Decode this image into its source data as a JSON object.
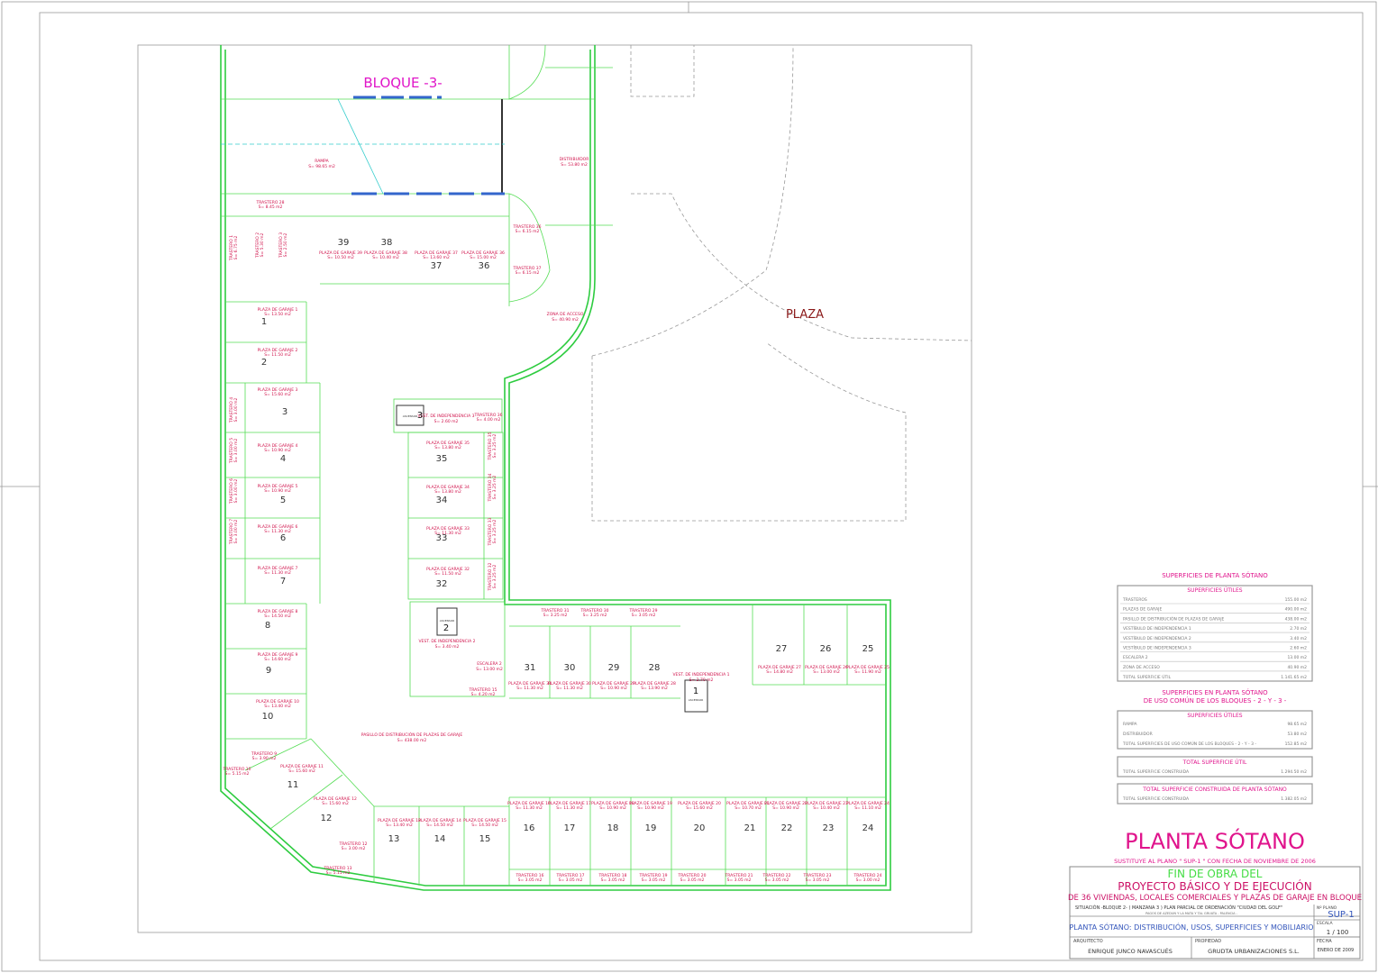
{
  "drawing": {
    "block_label": "BLOQUE -3-",
    "plaza_label": "PLAZA",
    "ramp": {
      "name": "RAMPA",
      "area": "S= 98.65 m2"
    },
    "distributor": {
      "name": "DISTRIBUIDOR",
      "area": "S= 53.80 m2"
    },
    "access_zone": {
      "name": "ZONA DE ACCESO",
      "area": "S= 40.90 m2"
    },
    "corridor": {
      "name": "PASILLO DE DISTRIBUCIÓN DE PLAZAS DE GARAJE",
      "area": "S= 438.00 m2"
    },
    "staircase": {
      "name": "ESCALERA 2",
      "area": "S= 13.00 m2"
    },
    "vestibules": [
      {
        "name": "VEST. DE INDEPENDENCIA 3",
        "area": "S= 2.60 m2"
      },
      {
        "name": "VEST. DE INDEPENDENCIA 2",
        "area": "S= 3.40 m2"
      },
      {
        "name": "VEST. DE INDEPENDENCIA 1",
        "area": "S= 2.70 m2"
      }
    ],
    "lifts": [
      "3",
      "2",
      "1"
    ],
    "lift_label": "ASCENSOR",
    "parking": [
      {
        "n": "1",
        "label": "PLAZA DE GARAJE 1",
        "area": "S= 13.50 m2"
      },
      {
        "n": "2",
        "label": "PLAZA DE GARAJE 2",
        "area": "S= 11.50 m2"
      },
      {
        "n": "3",
        "label": "PLAZA DE GARAJE 3",
        "area": "S= 15.60 m2"
      },
      {
        "n": "4",
        "label": "PLAZA DE GARAJE 4",
        "area": "S= 10.90 m2"
      },
      {
        "n": "5",
        "label": "PLAZA DE GARAJE 5",
        "area": "S= 10.90 m2"
      },
      {
        "n": "6",
        "label": "PLAZA DE GARAJE 6",
        "area": "S= 11.30 m2"
      },
      {
        "n": "7",
        "label": "PLAZA DE GARAJE 7",
        "area": "S= 11.30 m2"
      },
      {
        "n": "8",
        "label": "PLAZA DE GARAJE 8",
        "area": "S= 14.50 m2"
      },
      {
        "n": "9",
        "label": "PLAZA DE GARAJE 9",
        "area": "S= 14.60 m2"
      },
      {
        "n": "10",
        "label": "PLAZA DE GARAJE 10",
        "area": "S= 13.40 m2"
      },
      {
        "n": "11",
        "label": "PLAZA DE GARAJE 11",
        "area": "S= 15.60 m2"
      },
      {
        "n": "12",
        "label": "PLAZA DE GARAJE 12",
        "area": "S= 15.60 m2"
      },
      {
        "n": "13",
        "label": "PLAZA DE GARAJE 13",
        "area": "S= 13.40 m2"
      },
      {
        "n": "14",
        "label": "PLAZA DE GARAJE 14",
        "area": "S= 14.50 m2"
      },
      {
        "n": "15",
        "label": "PLAZA DE GARAJE 15",
        "area": "S= 14.50 m2"
      },
      {
        "n": "16",
        "label": "PLAZA DE GARAJE 16",
        "area": "S= 11.30 m2"
      },
      {
        "n": "17",
        "label": "PLAZA DE GARAJE 17",
        "area": "S= 11.30 m2"
      },
      {
        "n": "18",
        "label": "PLAZA DE GARAJE 18",
        "area": "S= 10.90 m2"
      },
      {
        "n": "19",
        "label": "PLAZA DE GARAJE 19",
        "area": "S= 10.90 m2"
      },
      {
        "n": "20",
        "label": "PLAZA DE GARAJE 20",
        "area": "S= 15.60 m2"
      },
      {
        "n": "21",
        "label": "PLAZA DE GARAJE 21",
        "area": "S= 10.70 m2"
      },
      {
        "n": "22",
        "label": "PLAZA DE GARAJE 22",
        "area": "S= 10.90 m2"
      },
      {
        "n": "23",
        "label": "PLAZA DE GARAJE 23",
        "area": "S= 10.40 m2"
      },
      {
        "n": "24",
        "label": "PLAZA DE GARAJE 24",
        "area": "S= 11.10 m2"
      },
      {
        "n": "25",
        "label": "PLAZA DE GARAJE 25",
        "area": "S= 11.90 m2"
      },
      {
        "n": "26",
        "label": "PLAZA DE GARAJE 26",
        "area": "S= 13.00 m2"
      },
      {
        "n": "27",
        "label": "PLAZA DE GARAJE 27",
        "area": "S= 14.80 m2"
      },
      {
        "n": "28",
        "label": "PLAZA DE GARAJE 28",
        "area": "S= 13.90 m2"
      },
      {
        "n": "29",
        "label": "PLAZA DE GARAJE 29",
        "area": "S= 10.90 m2"
      },
      {
        "n": "30",
        "label": "PLAZA DE GARAJE 30",
        "area": "S= 11.30 m2"
      },
      {
        "n": "31",
        "label": "PLAZA DE GARAJE 31",
        "area": "S= 11.30 m2"
      },
      {
        "n": "32",
        "label": "PLAZA DE GARAJE 32",
        "area": "S= 11.50 m2"
      },
      {
        "n": "33",
        "label": "PLAZA DE GARAJE 33",
        "area": "S= 11.30 m2"
      },
      {
        "n": "34",
        "label": "PLAZA DE GARAJE 34",
        "area": "S= 13.80 m2"
      },
      {
        "n": "35",
        "label": "PLAZA DE GARAJE 35",
        "area": "S= 13.80 m2"
      },
      {
        "n": "36",
        "label": "PLAZA DE GARAJE 36",
        "area": "S= 15.00 m2"
      },
      {
        "n": "37",
        "label": "PLAZA DE GARAJE 37",
        "area": "S= 13.60 m2"
      },
      {
        "n": "38",
        "label": "PLAZA DE GARAJE 38",
        "area": "S= 10.40 m2"
      },
      {
        "n": "39",
        "label": "PLAZA DE GARAJE 39",
        "area": "S= 10.50 m2"
      }
    ],
    "storage": [
      {
        "label": "TRASTERO 1",
        "area": "S= 6.75 m2"
      },
      {
        "label": "TRASTERO 2",
        "area": "S= 5.30 m2"
      },
      {
        "label": "TRASTERO 3",
        "area": "S= 2.50 m2"
      },
      {
        "label": "TRASTERO 4",
        "area": "S= 3.00 m2"
      },
      {
        "label": "TRASTERO 5",
        "area": "S= 3.00 m2"
      },
      {
        "label": "TRASTERO 6",
        "area": "S= 3.00 m2"
      },
      {
        "label": "TRASTERO 7",
        "area": "S= 3.00 m2"
      },
      {
        "label": "TRASTERO 9",
        "area": "S= 3.90 m2"
      },
      {
        "label": "TRASTERO 10",
        "area": "S= 5.15 m2"
      },
      {
        "label": "TRASTERO 12",
        "area": "S= 3.00 m2"
      },
      {
        "label": "TRASTERO 13",
        "area": "S= 5.15 m2"
      },
      {
        "label": "TRASTERO 16",
        "area": "S= 3.05 m2"
      },
      {
        "label": "TRASTERO 17",
        "area": "S= 3.05 m2"
      },
      {
        "label": "TRASTERO 18",
        "area": "S= 3.05 m2"
      },
      {
        "label": "TRASTERO 19",
        "area": "S= 3.05 m2"
      },
      {
        "label": "TRASTERO 20",
        "area": "S= 3.05 m2"
      },
      {
        "label": "TRASTERO 21",
        "area": "S= 3.05 m2"
      },
      {
        "label": "TRASTERO 22",
        "area": "S= 3.05 m2"
      },
      {
        "label": "TRASTERO 23",
        "area": "S= 3.05 m2"
      },
      {
        "label": "TRASTERO 24",
        "area": "S= 3.00 m2"
      },
      {
        "label": "TRASTERO 28",
        "area": "S= 8.45 m2"
      },
      {
        "label": "TRASTERO 29",
        "area": "S= 3.05 m2"
      },
      {
        "label": "TRASTERO 30",
        "area": "S= 3.25 m2"
      },
      {
        "label": "TRASTERO 31",
        "area": "S= 3.25 m2"
      },
      {
        "label": "TRASTERO 32",
        "area": "S= 3.25 m2"
      },
      {
        "label": "TRASTERO 33",
        "area": "S= 3.25 m2"
      },
      {
        "label": "TRASTERO 34",
        "area": "S= 3.25 m2"
      },
      {
        "label": "TRASTERO 35",
        "area": "S= 3.25 m2"
      },
      {
        "label": "TRASTERO 36",
        "area": "S= 4.00 m2"
      },
      {
        "label": "TRASTERO 15",
        "area": "S= 4.20 m2"
      },
      {
        "label": "TRASTERO 36",
        "area": "S= 6.15 m2"
      },
      {
        "label": "TRASTERO 37",
        "area": "S= 6.15 m2"
      }
    ]
  },
  "legend": {
    "title": "SUPERFICIES DE PLANTA SÓTANO",
    "useful_header": "SUPERFICIES ÚTILES",
    "useful_rows": [
      {
        "label": "TRASTEROS",
        "value": "155.00 m2"
      },
      {
        "label": "PLAZAS DE GARAJE",
        "value": "490.00 m2"
      },
      {
        "label": "PASILLO DE DISTRIBUCIÓN DE PLAZAS DE GARAJE",
        "value": "438.00 m2"
      },
      {
        "label": "VESTÍBULO DE INDEPENDENCIA 1",
        "value": "2.70 m2"
      },
      {
        "label": "VESTÍBULO DE INDEPENDENCIA 2",
        "value": "3.40 m2"
      },
      {
        "label": "VESTÍBULO DE INDEPENDENCIA 3",
        "value": "2.60 m2"
      },
      {
        "label": "ESCALERA 2",
        "value": "13.00 m2"
      },
      {
        "label": "ZONA DE ACCESO",
        "value": "40.90 m2"
      }
    ],
    "useful_total": {
      "label": "TOTAL SUPERFICIE ÚTIL",
      "value": "1.141.65 m2"
    },
    "common_title_1": "SUPERFICIES EN PLANTA SÓTANO",
    "common_title_2": "DE USO COMÚN DE LOS BLOQUES - 2 - Y - 3 -",
    "common_header": "SUPERFICIES ÚTILES",
    "common_rows": [
      {
        "label": "RAMPA",
        "value": "98.65 m2"
      },
      {
        "label": "DISTRIBUIDOR",
        "value": "53.80 m2"
      }
    ],
    "common_total": {
      "label": "TOTAL SUPERFICIES DE USO COMÚN DE LOS BLOQUES - 2 - Y - 3 -",
      "value": "152.85 m2"
    },
    "total_util_header": "TOTAL SUPERFICIE ÚTIL",
    "total_util_row": {
      "label": "TOTAL SUPERFICIE CONSTRUIDA",
      "value": "1.294.50 m2"
    },
    "total_built_header": "TOTAL SUPERFICIE CONSTRUIDA DE PLANTA SÓTANO",
    "total_built_row": {
      "label": "TOTAL SUPERFICIE CONSTRUIDA",
      "value": "1.382.05 m2"
    }
  },
  "sheet": {
    "big_title": "PLANTA SÓTANO",
    "substitution": "SUSTITUYE AL PLANO \" SUP-1 \" CON FECHA DE NOVIEMBRE DE 2006",
    "fin_obra": "FIN DE OBRA DEL",
    "project_line1": "PROYECTO BÁSICO Y DE EJECUCIÓN",
    "project_line2": "DE 36 VIVIENDAS, LOCALES COMERCIALES Y PLAZAS DE GARAJE EN BLOQUE",
    "situation": "SITUACIÓN  -BLOQUE 2-  ( MANZANA 3 )  PLAN PARCIAL DE ORDENACIÓN \"CIUDAD DEL GOLF\"",
    "situation_sub": "PAGOS DE AZEDUN Y LA MATA Y TAL GRUATA - PALENCIA -",
    "plan_no_label": "Nº PLANO",
    "plan_no": "SUP-1",
    "scale_label": "ESCALA",
    "scale": "1 / 100",
    "description": "PLANTA SÓTANO: DISTRIBUCIÓN, USOS, SUPERFICIES Y MOBILIARIO",
    "architect_label": "ARQUITECTO",
    "architect": "ENRIQUE JUNCO NAVASCUÉS",
    "owner_label": "PROPIEDAD",
    "owner": "GRUDTA URBANIZACIONES S.L.",
    "date_label": "FECHA",
    "date": "ENERO DE 2009"
  }
}
